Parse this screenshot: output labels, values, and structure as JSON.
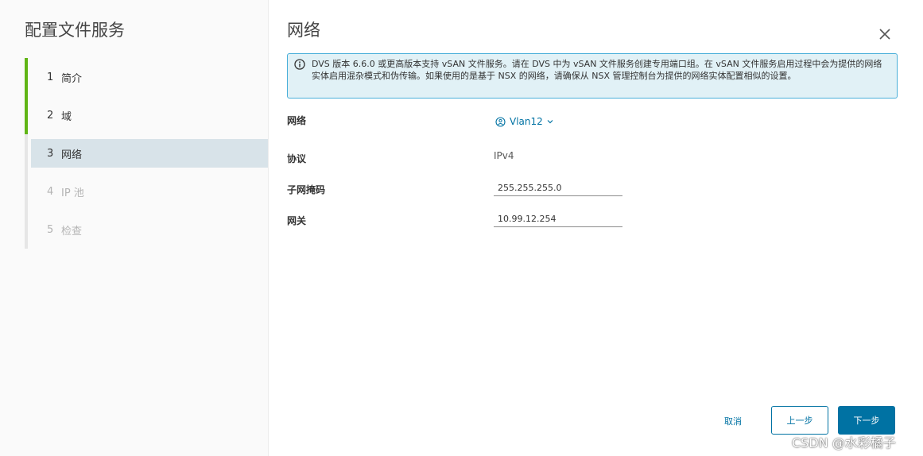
{
  "wizard": {
    "title": "配置文件服务",
    "steps": [
      {
        "num": "1",
        "label": "简介",
        "state": "done"
      },
      {
        "num": "2",
        "label": "域",
        "state": "done"
      },
      {
        "num": "3",
        "label": "网络",
        "state": "active"
      },
      {
        "num": "4",
        "label": "IP 池",
        "state": "disabled"
      },
      {
        "num": "5",
        "label": "检查",
        "state": "disabled"
      }
    ]
  },
  "page": {
    "title": "网络",
    "alert_text": "DVS 版本 6.6.0 或更高版本支持 vSAN 文件服务。请在 DVS 中为 vSAN 文件服务创建专用端口组。在 vSAN 文件服务启用过程中会为提供的网络实体启用混杂模式和伪传输。如果使用的是基于 NSX 的网络，请确保从 NSX 管理控制台为提供的网络实体配置相似的设置。"
  },
  "form": {
    "network_label": "网络",
    "network_value": "Vlan12",
    "protocol_label": "协议",
    "protocol_value": "IPv4",
    "subnet_label": "子网掩码",
    "subnet_value": "255.255.255.0",
    "gateway_label": "网关",
    "gateway_value": "10.99.12.254"
  },
  "footer": {
    "cancel_label": "取消",
    "prev_label": "上一步",
    "next_label": "下一步"
  },
  "watermark": "CSDN @水彩橘子",
  "colors": {
    "accent": "#0072a3",
    "done": "#60b515",
    "alert_border": "#49afd9",
    "alert_bg": "#e1f1f6",
    "active_step_bg": "#d8e3e9"
  },
  "icons": [
    "info-icon",
    "close-icon",
    "network-icon",
    "chevron-down-icon"
  ]
}
